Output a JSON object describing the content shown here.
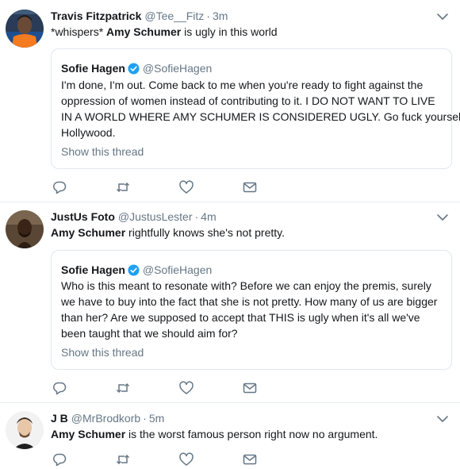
{
  "tweets": [
    {
      "name": "Travis Fitzpatrick",
      "handle": "@Tee__Fitz",
      "separator": "·",
      "time": "3m",
      "text_pre": "*whispers* ",
      "text_bold": "Amy Schumer",
      "text_post": " is ugly in this world",
      "quote": {
        "name": "Sofie Hagen",
        "handle": "@SofieHagen",
        "lines": [
          "I'm done, I'm out. Come back to me when you're ready to fight against the",
          "oppression of women instead of contributing to it. I DO NOT WANT TO LIVE",
          "IN A WORLD WHERE AMY SCHUMER IS CONSIDERED UGLY. Go fuck yourself,",
          "Hollywood."
        ],
        "show_thread": "Show this thread"
      }
    },
    {
      "name": "JustUs Foto",
      "handle": "@JustusLester",
      "separator": "·",
      "time": "4m",
      "text_pre": "",
      "text_bold": "Amy Schumer",
      "text_post": " rightfully knows she's not pretty.",
      "quote": {
        "name": "Sofie Hagen",
        "handle": "@SofieHagen",
        "lines": [
          "Who is this meant to resonate with? Before we can enjoy the premis, surely",
          "we have to buy into the fact that she is not pretty. How many of us are bigger",
          "than her? Are we supposed to accept that THIS is ugly when it's all we've",
          "been taught that we should aim for?"
        ],
        "show_thread": "Show this thread"
      }
    },
    {
      "name": "J B",
      "handle": "@MrBrodkorb",
      "separator": "·",
      "time": "5m",
      "text_pre": "",
      "text_bold": "Amy Schumer",
      "text_post": " is the worst famous person right now no argument."
    }
  ],
  "icons": {
    "reply": "reply-icon",
    "retweet": "retweet-icon",
    "like": "heart-icon",
    "dm": "message-icon",
    "more": "chevron-down-icon",
    "verified": "verified-badge-icon"
  },
  "colors": {
    "icon": "#657786",
    "verified": "#1da1f2",
    "border": "#e6ecf0"
  }
}
